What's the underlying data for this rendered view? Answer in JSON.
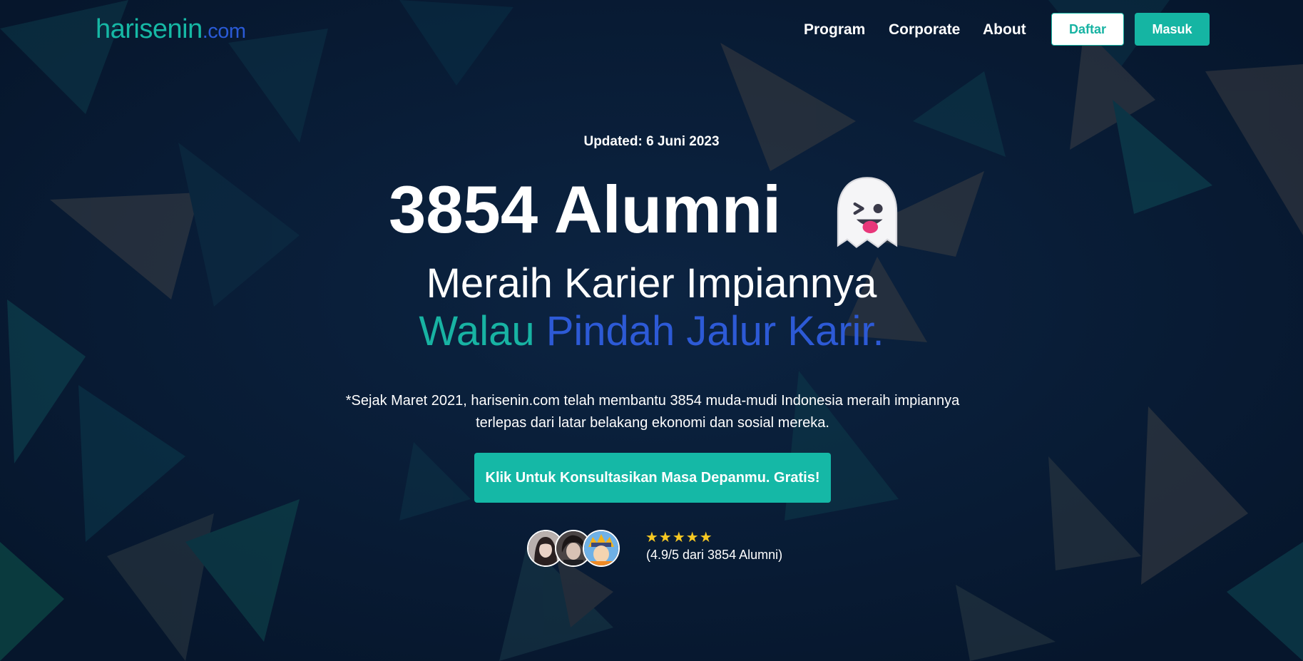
{
  "nav": {
    "logo_main": "harisenin",
    "logo_tld": ".com",
    "links": [
      "Program",
      "Corporate",
      "About"
    ],
    "daftar_label": "Daftar",
    "masuk_label": "Masuk"
  },
  "hero": {
    "updated": "Updated: 6 Juni 2023",
    "headline": "3854 Alumni",
    "subline1": "Meraih Karier Impiannya",
    "subline2_teal": "Walau",
    "subline2_blue": "Pindah Jalur Karir.",
    "description_line1": "*Sejak Maret 2021, harisenin.com telah membantu 3854 muda-mudi Indonesia meraih impiannya",
    "description_line2": "terlepas dari latar belakang ekonomi dan sosial mereka.",
    "cta_label": "Klik Untuk Konsultasikan Masa Depanmu. Gratis!",
    "stars": "★★★★★",
    "rating_text": "(4.9/5 dari 3854 Alumni)",
    "rating_value": 4.9
  },
  "colors": {
    "accent_teal": "#15b5a3",
    "accent_blue": "#2d5ad6",
    "background": "#081a33",
    "star": "#f6c823"
  },
  "icons": [
    "ghost-wink-icon",
    "star-icon"
  ]
}
